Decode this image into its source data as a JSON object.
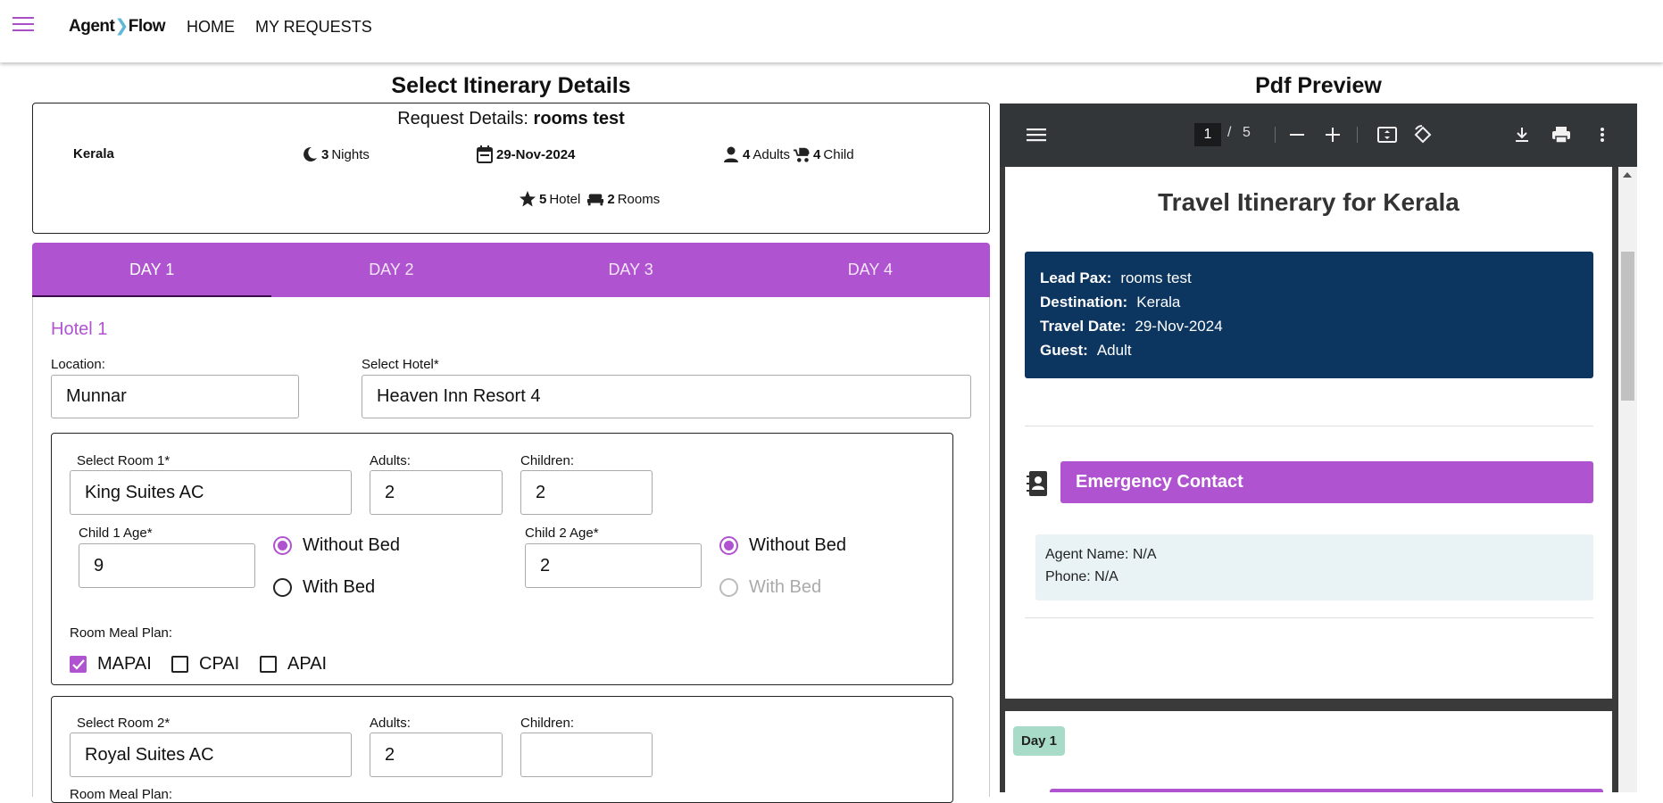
{
  "nav": {
    "logo_a": "Agent",
    "logo_b": "Flow",
    "home": "HOME",
    "my_requests": "MY REQUESTS"
  },
  "left": {
    "title": "Select Itinerary Details",
    "request": {
      "prefix": "Request Details:",
      "name": "rooms test",
      "destination": "Kerala",
      "nights_count": "3",
      "nights_label": "Nights",
      "date": "29-Nov-2024",
      "adults_count": "4",
      "adults_label": "Adults",
      "child_count": "4",
      "child_label": "Child",
      "hotel_star": "5",
      "hotel_label": "Hotel",
      "rooms_count": "2",
      "rooms_label": "Rooms"
    },
    "tabs": [
      "DAY 1",
      "DAY 2",
      "DAY 3",
      "DAY 4"
    ],
    "hotel": {
      "heading": "Hotel 1",
      "location_label": "Location:",
      "location_value": "Munnar",
      "select_hotel_label": "Select Hotel*",
      "select_hotel_value": "Heaven Inn Resort 4"
    },
    "room1": {
      "select_label": "Select Room 1*",
      "select_value": "King Suites AC",
      "adults_label": "Adults:",
      "adults_value": "2",
      "children_label": "Children:",
      "children_value": "2",
      "child1_label": "Child 1 Age*",
      "child1_value": "9",
      "child2_label": "Child 2 Age*",
      "child2_value": "2",
      "without_bed": "Without Bed",
      "with_bed": "With Bed",
      "meal_label": "Room Meal Plan:",
      "meals": [
        "MAPAI",
        "CPAI",
        "APAI"
      ]
    },
    "room2": {
      "select_label": "Select Room 2*",
      "select_value": "Royal Suites AC",
      "adults_label": "Adults:",
      "adults_value": "2",
      "children_label": "Children:",
      "children_value": "",
      "meal_label": "Room Meal Plan:"
    }
  },
  "right": {
    "title": "Pdf Preview",
    "toolbar": {
      "page_current": "1",
      "page_sep": "/",
      "page_total": "5"
    },
    "pdf": {
      "title": "Travel Itinerary for Kerala",
      "lead_pax_k": "Lead Pax:",
      "lead_pax_v": "rooms test",
      "destination_k": "Destination:",
      "destination_v": "Kerala",
      "travel_date_k": "Travel Date:",
      "travel_date_v": "29-Nov-2024",
      "guest_k": "Guest:",
      "guest_v": "Adult",
      "emergency_title": "Emergency Contact",
      "agent_name": "Agent Name: N/A",
      "phone": "Phone: N/A",
      "day_badge": "Day 1"
    }
  },
  "colors": {
    "accent": "#b053d0",
    "navy": "#0c3560",
    "pdf_toolbar": "#323639"
  }
}
